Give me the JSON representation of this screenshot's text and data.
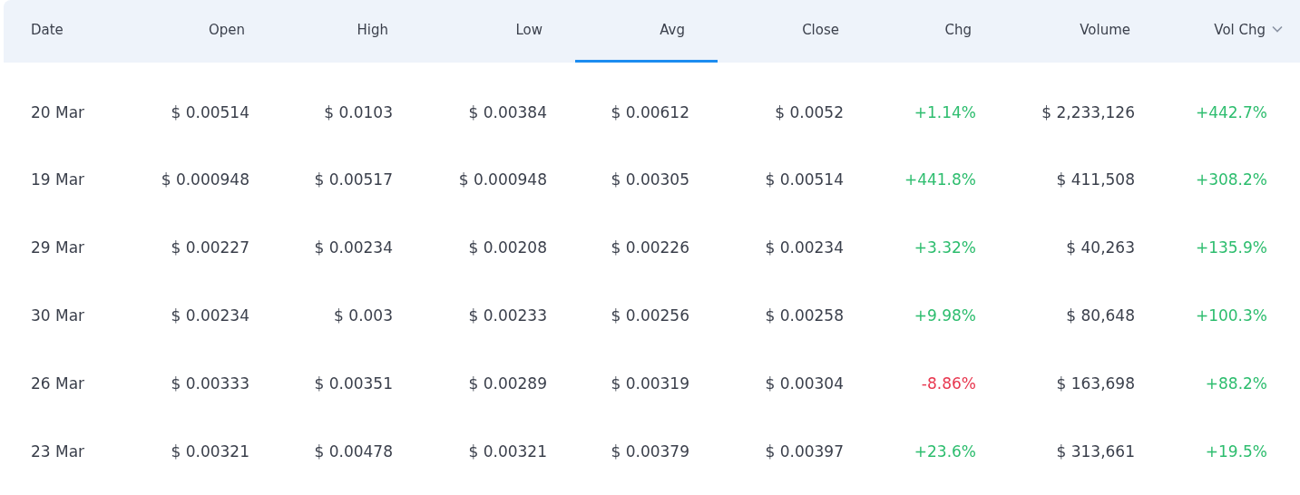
{
  "table": {
    "columns": [
      {
        "label": "Date",
        "selected": false,
        "sorted": false
      },
      {
        "label": "Open",
        "selected": false,
        "sorted": false
      },
      {
        "label": "High",
        "selected": false,
        "sorted": false
      },
      {
        "label": "Low",
        "selected": false,
        "sorted": false
      },
      {
        "label": "Avg",
        "selected": true,
        "sorted": false
      },
      {
        "label": "Close",
        "selected": false,
        "sorted": false
      },
      {
        "label": "Chg",
        "selected": false,
        "sorted": false
      },
      {
        "label": "Volume",
        "selected": false,
        "sorted": false
      },
      {
        "label": "Vol Chg",
        "selected": false,
        "sorted": true
      }
    ],
    "rows": [
      {
        "cells": [
          "20 Mar",
          "$ 0.00514",
          "$ 0.0103",
          "$ 0.00384",
          "$ 0.00612",
          "$ 0.0052",
          {
            "text": "+1.14%",
            "color": "#2dbd6e"
          },
          "$ 2,233,126",
          {
            "text": "+442.7%",
            "color": "#2dbd6e"
          }
        ]
      },
      {
        "cells": [
          "19 Mar",
          "$ 0.000948",
          "$ 0.00517",
          "$ 0.000948",
          "$ 0.00305",
          "$ 0.00514",
          {
            "text": "+441.8%",
            "color": "#2dbd6e"
          },
          "$ 411,508",
          {
            "text": "+308.2%",
            "color": "#2dbd6e"
          }
        ]
      },
      {
        "cells": [
          "29 Mar",
          "$ 0.00227",
          "$ 0.00234",
          "$ 0.00208",
          "$ 0.00226",
          "$ 0.00234",
          {
            "text": "+3.32%",
            "color": "#2dbd6e"
          },
          "$ 40,263",
          {
            "text": "+135.9%",
            "color": "#2dbd6e"
          }
        ]
      },
      {
        "cells": [
          "30 Mar",
          "$ 0.00234",
          "$ 0.003",
          "$ 0.00233",
          "$ 0.00256",
          "$ 0.00258",
          {
            "text": "+9.98%",
            "color": "#2dbd6e"
          },
          "$ 80,648",
          {
            "text": "+100.3%",
            "color": "#2dbd6e"
          }
        ]
      },
      {
        "cells": [
          "26 Mar",
          "$ 0.00333",
          "$ 0.00351",
          "$ 0.00289",
          "$ 0.00319",
          "$ 0.00304",
          {
            "text": "-8.86%",
            "color": "#e8374f"
          },
          "$ 163,698",
          {
            "text": "+88.2%",
            "color": "#2dbd6e"
          }
        ]
      },
      {
        "cells": [
          "23 Mar",
          "$ 0.00321",
          "$ 0.00478",
          "$ 0.00321",
          "$ 0.00379",
          "$ 0.00397",
          {
            "text": "+23.6%",
            "color": "#2dbd6e"
          },
          "$ 313,661",
          {
            "text": "+19.5%",
            "color": "#2dbd6e"
          }
        ]
      }
    ]
  }
}
